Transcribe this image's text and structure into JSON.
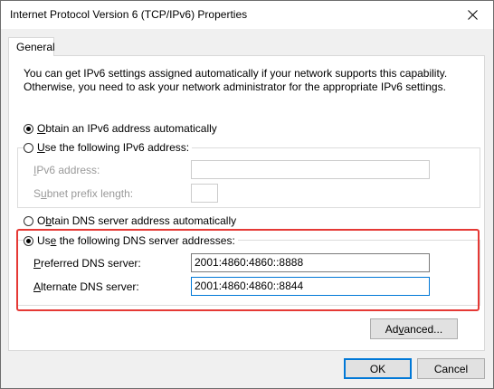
{
  "window": {
    "title": "Internet Protocol Version 6 (TCP/IPv6) Properties"
  },
  "tabs": [
    {
      "label": "General"
    }
  ],
  "intro_text": "You can get IPv6 settings assigned automatically if your network supports this capability. Otherwise, you need to ask your network administrator for the appropriate IPv6 settings.",
  "ip_section": {
    "auto": {
      "key": "O",
      "rest": "btain an IPv6 address automatically",
      "checked": true
    },
    "manual": {
      "key": "U",
      "rest": "se the following IPv6 address:",
      "checked": false
    },
    "ipv6_address": {
      "key": "I",
      "rest": "Pv6 address:",
      "value": ""
    },
    "subnet_prefix": {
      "key": "u",
      "pre": "S",
      "rest": "bnet prefix length:",
      "value": ""
    }
  },
  "dns_section": {
    "auto": {
      "pre": "O",
      "key": "b",
      "rest": "tain DNS server address automatically",
      "checked": false
    },
    "manual": {
      "pre": "Us",
      "key": "e",
      "rest": " the following DNS server addresses:",
      "checked": true
    },
    "preferred": {
      "key": "P",
      "rest": "referred DNS server:",
      "value": "2001:4860:4860::8888"
    },
    "alternate": {
      "key": "A",
      "rest": "lternate DNS server:",
      "value": "2001:4860:4860::8844"
    }
  },
  "buttons": {
    "advanced_pre": "Ad",
    "advanced_key": "v",
    "advanced_rest": "anced...",
    "ok": "OK",
    "cancel": "Cancel"
  },
  "colors": {
    "highlight": "#e53935",
    "focus": "#0078d7"
  }
}
